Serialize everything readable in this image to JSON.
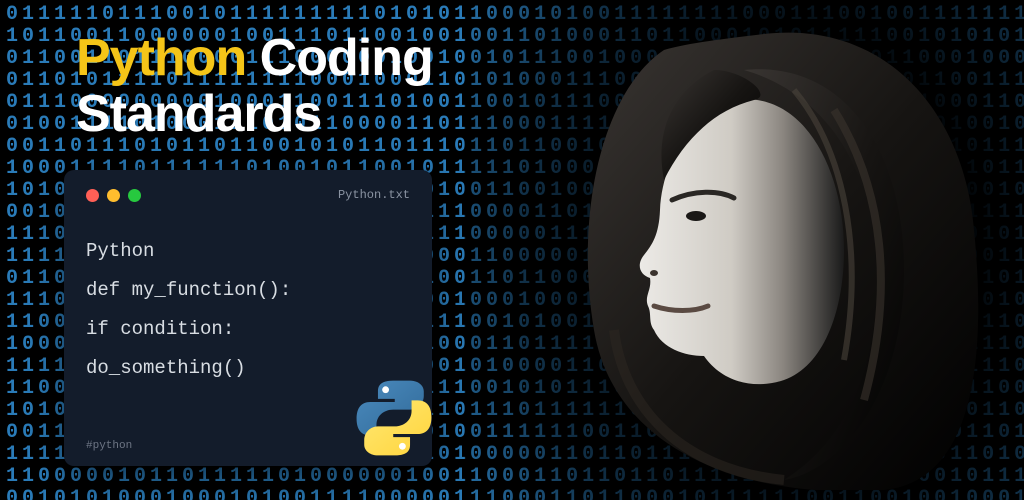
{
  "headline": {
    "word1": "Python",
    "word2": "Coding",
    "word3": "Standards"
  },
  "code_card": {
    "filename": "Python.txt",
    "lines": {
      "l1": "Python",
      "l2": "def my_function():",
      "l3": "if condition:",
      "l4": "do_something()"
    },
    "hashtag": "#python"
  },
  "icons": {
    "traffic_red": "close-icon",
    "traffic_yellow": "minimize-icon",
    "traffic_green": "zoom-icon",
    "python_logo": "python-logo-icon"
  },
  "background": {
    "binary_char_set": "01"
  }
}
